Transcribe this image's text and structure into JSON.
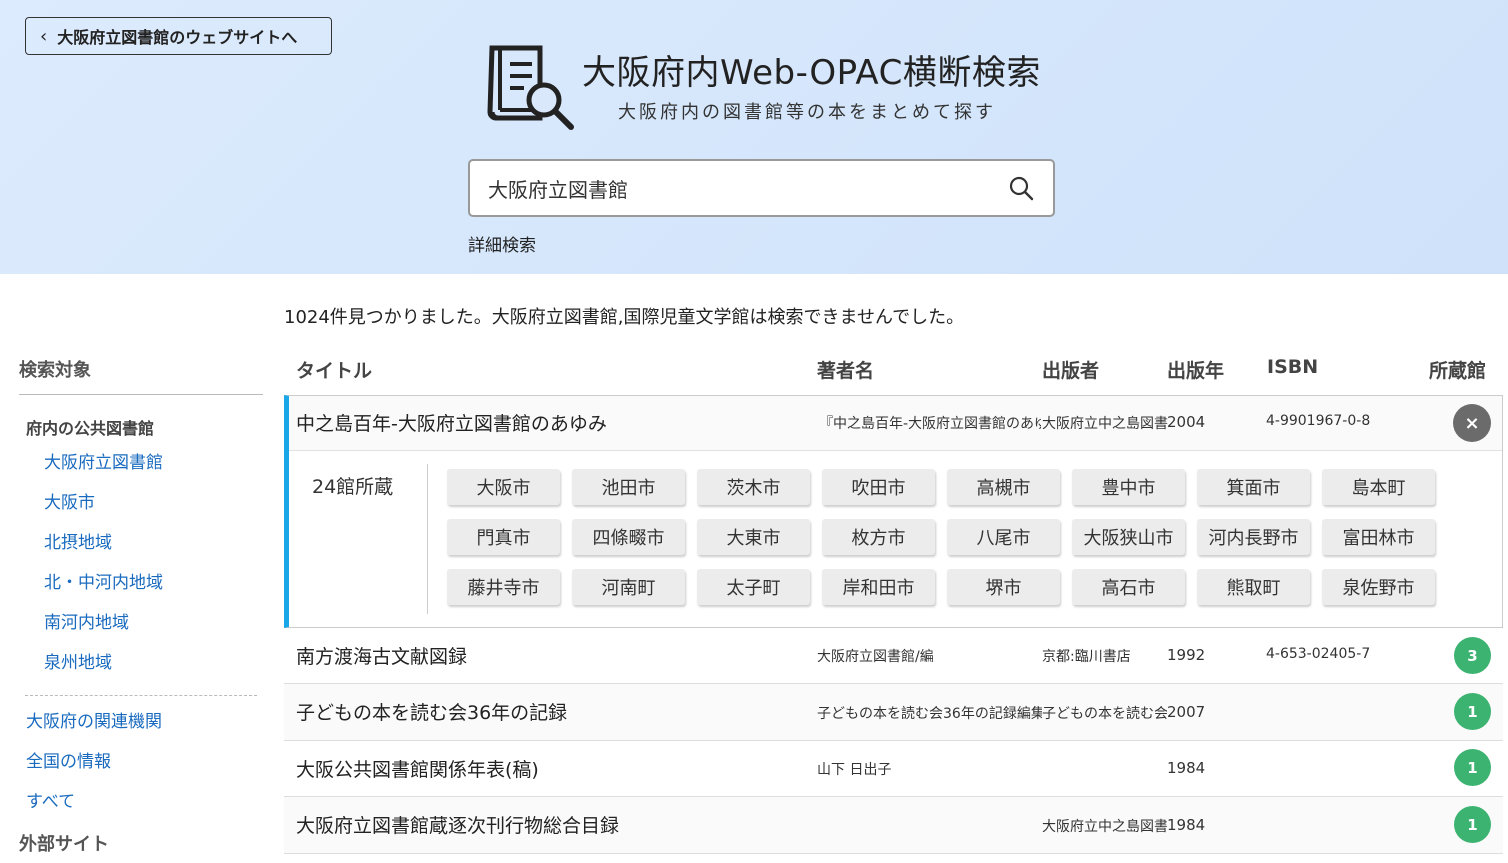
{
  "header": {
    "back_label": "大阪府立図書館のウェブサイトへ",
    "title": "大阪府内Web-OPAC横断検索",
    "subtitle": "大阪府内の図書館等の本をまとめて探す",
    "search_value": "大阪府立図書館",
    "advanced_search": "詳細検索"
  },
  "result_message": "1024件見つかりました。大阪府立図書館,国際児童文学館は検索できませんでした。",
  "sidebar": {
    "heading": "検索対象",
    "group_label": "府内の公共図書館",
    "sub_items": [
      "大阪府立図書館",
      "大阪市",
      "北摂地域",
      "北・中河内地域",
      "南河内地域",
      "泉州地域"
    ],
    "links": [
      "大阪府の関連機関",
      "全国の情報",
      "すべて"
    ],
    "heading2": "外部サイト"
  },
  "columns": {
    "title": "タイトル",
    "author": "著者名",
    "publisher": "出版者",
    "year": "出版年",
    "isbn": "ISBN",
    "holdings": "所蔵館"
  },
  "expanded": {
    "title": "中之島百年-大阪府立図書館のあゆみ",
    "author": "『中之島百年-大阪府立図書館のあゆ",
    "publisher": "大阪府立中之島図書",
    "year": "2004",
    "isbn": "4-9901967-0-8",
    "close_label": "×",
    "holding_count": "24館所蔵",
    "libraries": [
      "大阪市",
      "池田市",
      "茨木市",
      "吹田市",
      "高槻市",
      "豊中市",
      "箕面市",
      "島本町",
      "門真市",
      "四條畷市",
      "大東市",
      "枚方市",
      "八尾市",
      "大阪狭山市",
      "河内長野市",
      "富田林市",
      "藤井寺市",
      "河南町",
      "太子町",
      "岸和田市",
      "堺市",
      "高石市",
      "熊取町",
      "泉佐野市"
    ]
  },
  "rows": [
    {
      "title": "南方渡海古文献図録",
      "author": "大阪府立図書館/編",
      "publisher": "京都:臨川書店",
      "year": "1992",
      "isbn": "4-653-02405-7",
      "count": "3"
    },
    {
      "title": "子どもの本を読む会36年の記録",
      "author": "子どもの本を読む会36年の記録編集",
      "publisher": "子どもの本を読む会",
      "year": "2007",
      "isbn": "",
      "count": "1"
    },
    {
      "title": "大阪公共図書館関係年表(稿)",
      "author": "山下 日出子",
      "publisher": "",
      "year": "1984",
      "isbn": "",
      "count": "1"
    },
    {
      "title": "大阪府立図書館蔵逐次刊行物総合目録",
      "author": "",
      "publisher": "大阪府立中之島図書",
      "year": "1984",
      "isbn": "",
      "count": "1"
    }
  ],
  "colors": {
    "accent": "#1aa7e8",
    "badge": "#3cb371",
    "link": "#1a6bbf",
    "header_bg": "#d6e8fc"
  }
}
